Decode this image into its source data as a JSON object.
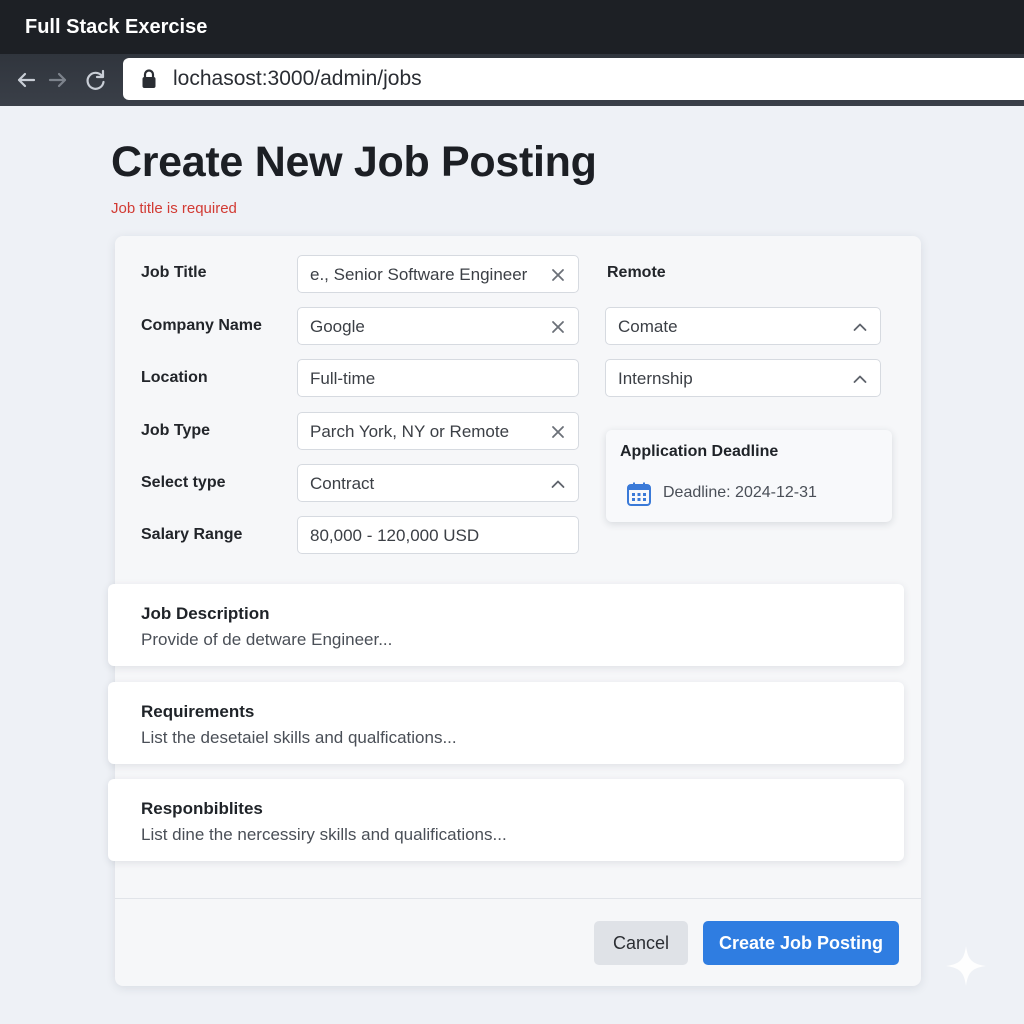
{
  "window": {
    "title": "Full Stack Exercise"
  },
  "browser": {
    "url": "lochasost:3000/admin/jobs"
  },
  "page": {
    "title": "Create New Job Posting",
    "error": "Job title is required"
  },
  "form": {
    "job_title": {
      "label": "Job Title",
      "value": "e., Senior Software Engineer"
    },
    "company_name": {
      "label": "Company Name",
      "value": "Google"
    },
    "location": {
      "label": "Location",
      "value": "Full-time"
    },
    "job_type": {
      "label": "Job Type",
      "value": "Parch York, NY or Remote"
    },
    "select_type": {
      "label": "Select type",
      "value": "Contract"
    },
    "salary_range": {
      "label": "Salary Range",
      "value": "80,000 - 120,000 USD"
    },
    "remote": {
      "label": "Remote",
      "options_shown": [
        "Comate",
        "Internship"
      ]
    },
    "deadline": {
      "title": "Application Deadline",
      "value": "Deadline: 2024-12-31"
    }
  },
  "textareas": [
    {
      "label": "Job Description",
      "placeholder": "Provide of de detware Engineer..."
    },
    {
      "label": "Requirements",
      "placeholder": "List the desetaiel skills and qualfications..."
    },
    {
      "label": "Responbiblites",
      "placeholder": "List dine the nercessiry skills and qualifications..."
    }
  ],
  "actions": {
    "cancel": "Cancel",
    "create": "Create Job Posting"
  },
  "colors": {
    "primary": "#2f7de1",
    "error": "#d23b34",
    "chrome": "#1d2025"
  },
  "icons": [
    "back-arrow-icon",
    "forward-arrow-icon",
    "reload-icon",
    "lock-icon",
    "clear-icon",
    "chevron-up-icon",
    "calendar-icon",
    "sparkle-icon"
  ]
}
